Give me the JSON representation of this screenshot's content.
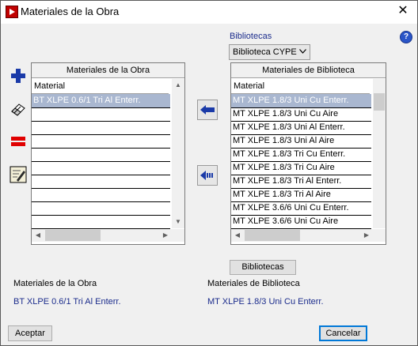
{
  "window": {
    "title": "Materiales de la Obra",
    "close_symbol": "✕"
  },
  "icons": {
    "app": "app-logo-icon",
    "help": "help-icon",
    "help_glyph": "?"
  },
  "toolbar": [
    {
      "name": "add-icon"
    },
    {
      "name": "eraser-icon"
    },
    {
      "name": "delete-icon"
    },
    {
      "name": "edit-icon"
    }
  ],
  "left_panel": {
    "header": "Materiales de la Obra",
    "column": "Material",
    "rows": [
      "BT XLPE 0.6/1 Tri Al Enterr.",
      "",
      "",
      "",
      "",
      "",
      "",
      "",
      "",
      ""
    ],
    "selected_index": 0
  },
  "library": {
    "label": "Bibliotecas",
    "combo_value": "Biblioteca CYPE",
    "header": "Materiales de Biblioteca",
    "column": "Material",
    "rows": [
      "MT XLPE 1.8/3 Uni Cu Enterr.",
      "MT XLPE 1.8/3 Uni Cu Aire",
      "MT XLPE 1.8/3 Uni Al Enterr.",
      "MT XLPE 1.8/3 Uni Al Aire",
      "MT XLPE 1.8/3 Tri Cu Enterr.",
      "MT XLPE 1.8/3 Tri Cu Aire",
      "MT XLPE 1.8/3 Tri Al Enterr.",
      "MT XLPE 1.8/3 Tri Al Aire",
      "MT XLPE 3.6/6 Uni Cu Enterr.",
      "MT XLPE 3.6/6 Uni Cu Aire"
    ],
    "selected_index": 0,
    "button": "Bibliotecas"
  },
  "summary": {
    "obra_label": "Materiales de la Obra",
    "obra_value": "BT XLPE 0.6/1 Tri Al Enterr.",
    "biblio_label": "Materiales de Biblioteca",
    "biblio_value": "MT XLPE 1.8/3 Uni Cu Enterr."
  },
  "buttons": {
    "accept": "Aceptar",
    "cancel": "Cancelar"
  },
  "colors": {
    "selection": "#a9b7d0",
    "summary_text": "#1b2c8c",
    "arrow_blue": "#1a3aa8"
  }
}
